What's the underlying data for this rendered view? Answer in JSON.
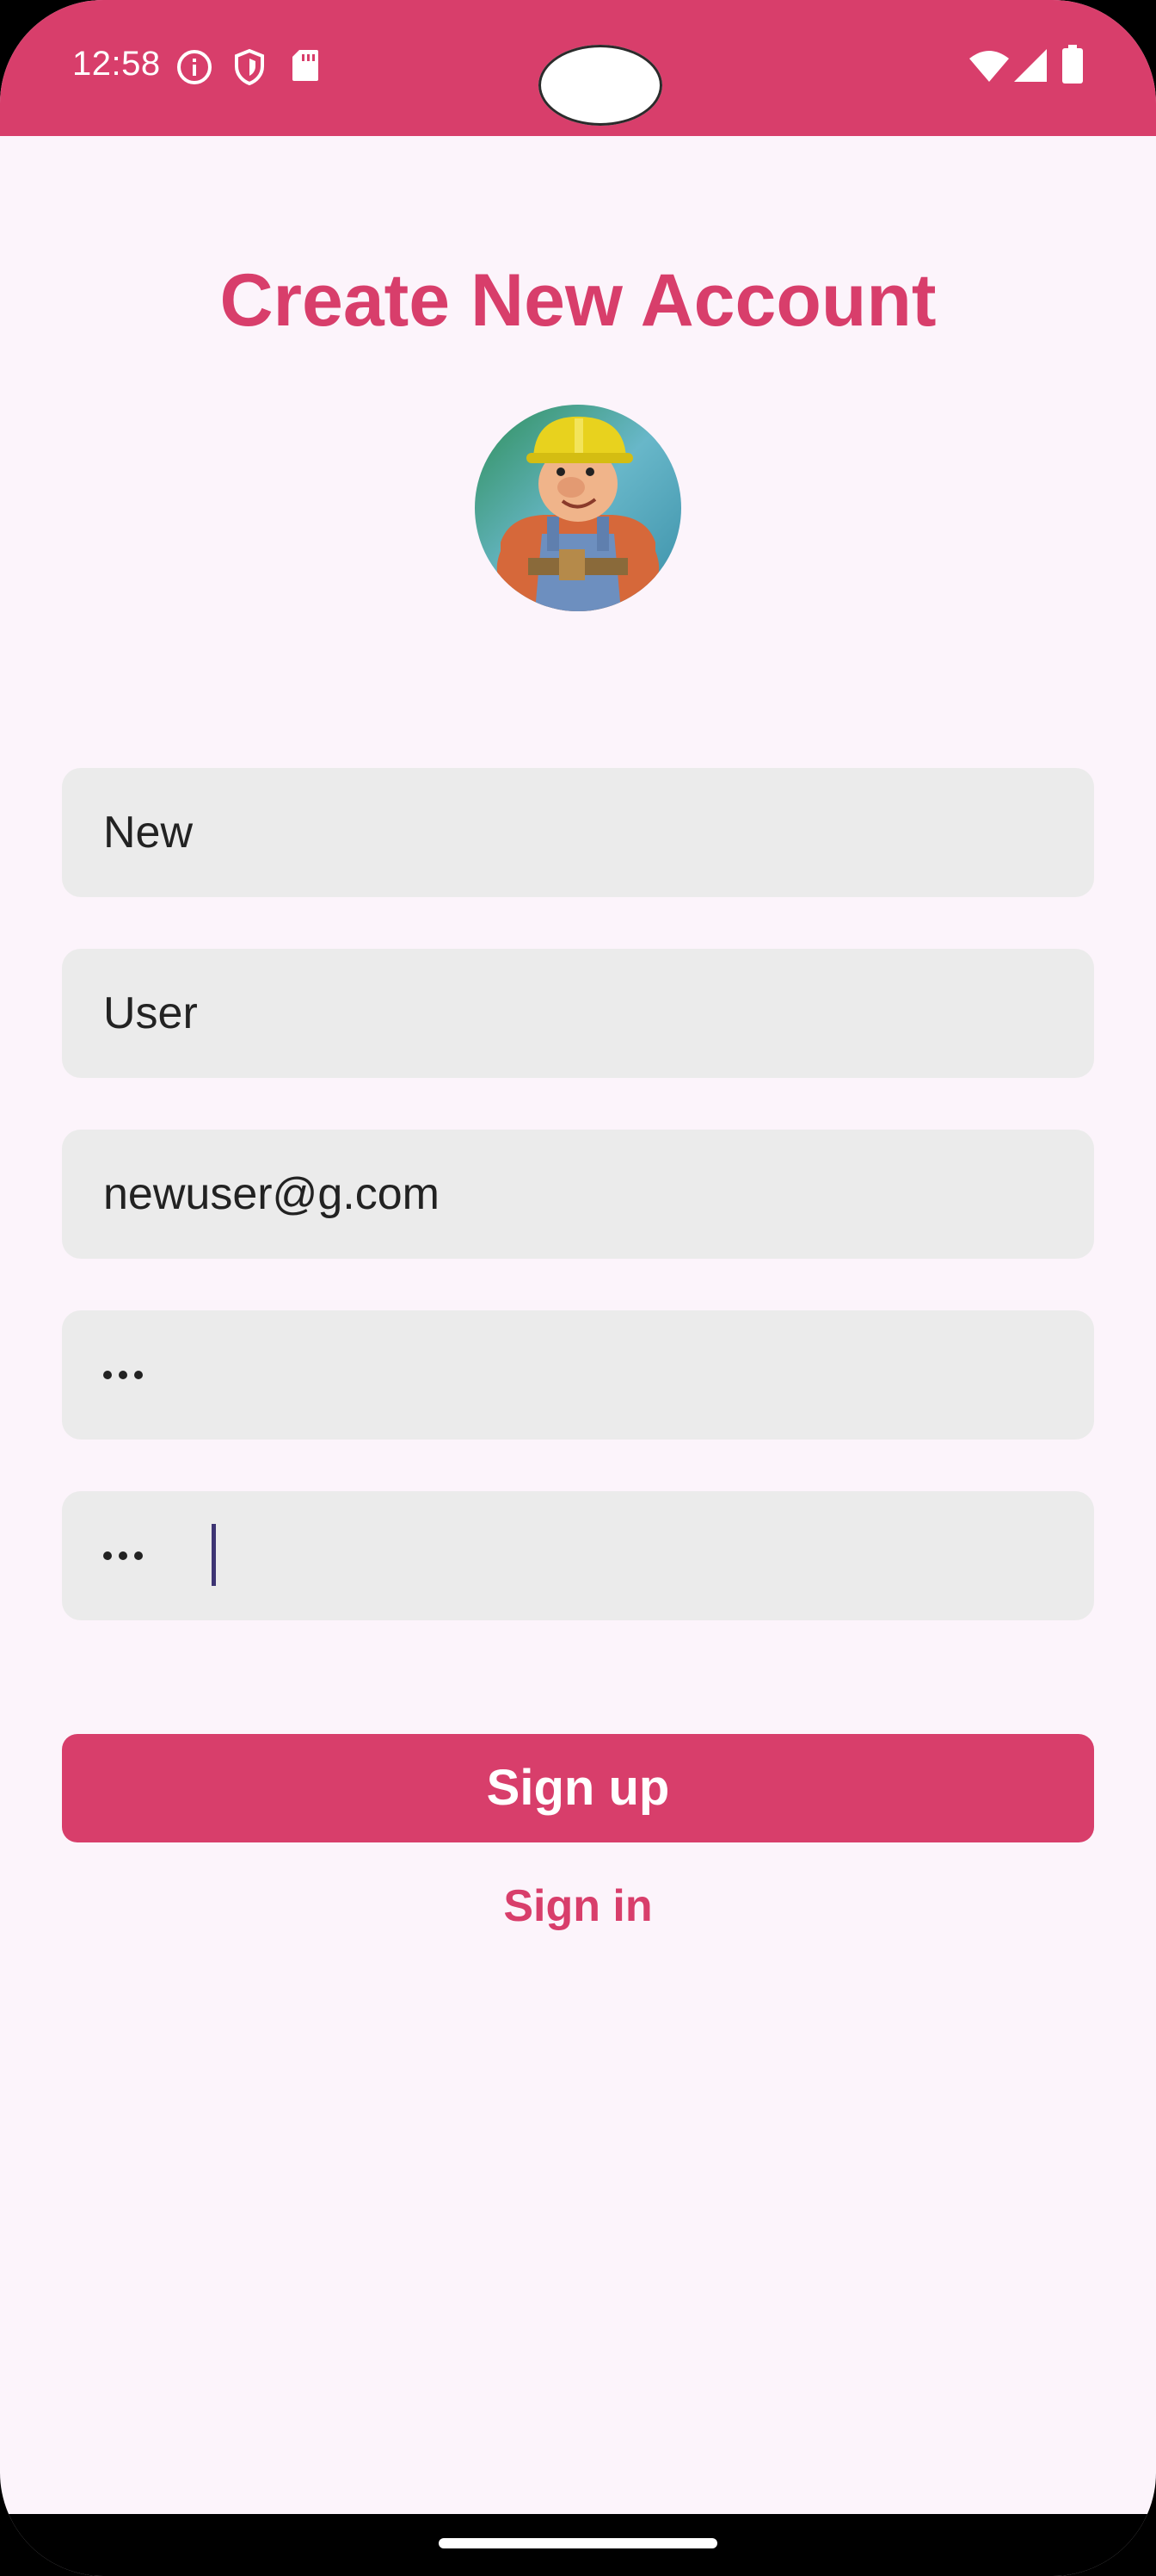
{
  "status_bar": {
    "time": "12:58",
    "icons": [
      "info-icon",
      "shield-icon",
      "sd-card-icon",
      "wifi-icon",
      "signal-icon",
      "battery-icon"
    ],
    "color": "#d83e6b"
  },
  "screen": {
    "title": "Create New Account",
    "avatar": "avatar-image"
  },
  "form": {
    "first_name": "New",
    "last_name": "User",
    "email": "newuser@g.com",
    "password_dots": 3,
    "confirm_password_dots": 3
  },
  "actions": {
    "sign_up_label": "Sign up",
    "sign_in_label": "Sign in"
  },
  "colors": {
    "accent": "#d83e6b",
    "background": "#fcf4fb",
    "field_background": "#ebebeb"
  }
}
